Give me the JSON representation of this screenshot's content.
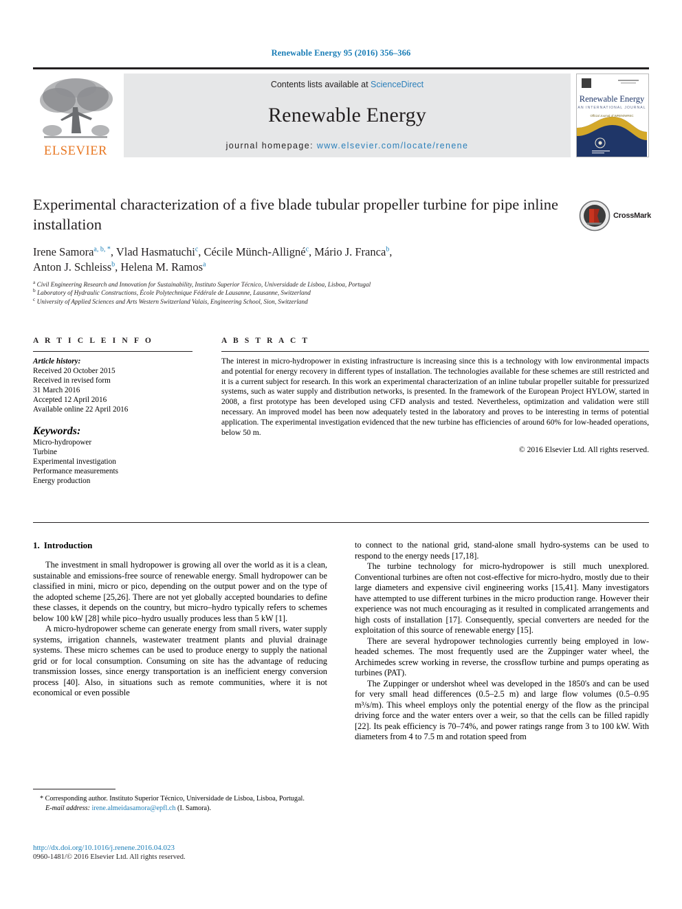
{
  "running_head": "Renewable Energy 95 (2016) 356–366",
  "masthead": {
    "publisher_name": "ELSEVIER",
    "contents_prefix": "Contents lists available at ",
    "contents_link": "ScienceDirect",
    "journal_title": "Renewable Energy",
    "homepage_prefix": "journal homepage: ",
    "homepage_url": "www.elsevier.com/locate/renene",
    "cover": {
      "title": "Renewable Energy",
      "subtitle": "AN INTERNATIONAL JOURNAL"
    }
  },
  "article": {
    "title": "Experimental characterization of a five blade tubular propeller turbine for pipe inline installation",
    "authors_line1": "Irene Samora",
    "authors_line1_sup": "a, b, *",
    "authors": [
      {
        "name": "Irene Samora",
        "sup": "a, b, *"
      },
      {
        "name": "Vlad Hasmatuchi",
        "sup": "c"
      },
      {
        "name": "Cécile Münch-Alligné",
        "sup": "c"
      },
      {
        "name": "Mário J. Franca",
        "sup": "b"
      },
      {
        "name": "Anton J. Schleiss",
        "sup": "b"
      },
      {
        "name": "Helena M. Ramos",
        "sup": "a"
      }
    ],
    "affiliations": [
      {
        "sup": "a",
        "text": "Civil Engineering Research and Innovation for Sustainability, Instituto Superior Técnico, Universidade de Lisboa, Lisboa, Portugal"
      },
      {
        "sup": "b",
        "text": "Laboratory of Hydraulic Constructions, École Polytechnique Fédérale de Lausanne, Lausanne, Switzerland"
      },
      {
        "sup": "c",
        "text": "University of Applied Sciences and Arts Western Switzerland Valais, Engineering School, Sion, Switzerland"
      }
    ],
    "crossmark_label": "CrossMark"
  },
  "article_info": {
    "heading": "A R T I C L E   I N F O",
    "history_label": "Article history:",
    "history": [
      "Received 20 October 2015",
      "Received in revised form",
      "31 March 2016",
      "Accepted 12 April 2016",
      "Available online 22 April 2016"
    ],
    "keywords_label": "Keywords:",
    "keywords": [
      "Micro-hydropower",
      "Turbine",
      "Experimental investigation",
      "Performance measurements",
      "Energy production"
    ]
  },
  "abstract": {
    "heading": "A B S T R A C T",
    "text": "The interest in micro-hydropower in existing infrastructure is increasing since this is a technology with low environmental impacts and potential for energy recovery in different types of installation. The technologies available for these schemes are still restricted and it is a current subject for research. In this work an experimental characterization of an inline tubular propeller suitable for pressurized systems, such as water supply and distribution networks, is presented. In the framework of the European Project HYLOW, started in 2008, a first prototype has been developed using CFD analysis and tested. Nevertheless, optimization and validation were still necessary. An improved model has been now adequately tested in the laboratory and proves to be interesting in terms of potential application. The experimental investigation evidenced that the new turbine has efficiencies of around 60% for low-headed operations, below 50 m.",
    "copyright": "© 2016 Elsevier Ltd. All rights reserved."
  },
  "body": {
    "section_number": "1.",
    "section_title": "Introduction",
    "left_paragraphs": [
      "The investment in small hydropower is growing all over the world as it is a clean, sustainable and emissions-free source of renewable energy. Small hydropower can be classified in mini, micro or pico, depending on the output power and on the type of the adopted scheme [25,26]. There are not yet globally accepted boundaries to define these classes, it depends on the country, but micro–hydro typically refers to schemes below 100 kW [28] while pico–hydro usually produces less than 5 kW [1].",
      "A micro-hydropower scheme can generate energy from small rivers, water supply systems, irrigation channels, wastewater treatment plants and pluvial drainage systems. These micro schemes can be used to produce energy to supply the national grid or for local consumption. Consuming on site has the advantage of reducing transmission losses, since energy transportation is an inefficient energy conversion process [40]. Also, in situations such as remote communities, where it is not economical or even possible"
    ],
    "right_paragraphs": [
      "to connect to the national grid, stand-alone small hydro-systems can be used to respond to the energy needs [17,18].",
      "The turbine technology for micro-hydropower is still much unexplored. Conventional turbines are often not cost-effective for micro-hydro, mostly due to their large diameters and expensive civil engineering works [15,41]. Many investigators have attempted to use different turbines in the micro production range. However their experience was not much encouraging as it resulted in complicated arrangements and high costs of installation [17]. Consequently, special converters are needed for the exploitation of this source of renewable energy [15].",
      "There are several hydropower technologies currently being employed in low-headed schemes. The most frequently used are the Zuppinger water wheel, the Archimedes screw working in reverse, the crossflow turbine and pumps operating as turbines (PAT).",
      "The Zuppinger or undershot wheel was developed in the 1850's and can be used for very small head differences (0.5–2.5 m) and large flow volumes (0.5–0.95 m³/s/m). This wheel employs only the potential energy of the flow as the principal driving force and the water enters over a weir, so that the cells can be filled rapidly [22]. Its peak efficiency is 70–74%, and power ratings range from 3 to 100 kW. With diameters from 4 to 7.5 m and rotation speed from"
    ]
  },
  "footnote": {
    "corresponding": "* Corresponding author. Instituto Superior Técnico, Universidade de Lisboa, Lisboa, Portugal.",
    "email_label": "E-mail address:",
    "email": "irene.almeidasamora@epfl.ch",
    "email_suffix": "(I. Samora)."
  },
  "footer": {
    "doi": "http://dx.doi.org/10.1016/j.renene.2016.04.023",
    "issn": "0960-1481/© 2016 Elsevier Ltd. All rights reserved."
  },
  "colors": {
    "link": "#1a7db6",
    "elsevier_orange": "#e87722",
    "masthead_grey": "#e6e7e8",
    "cover_navy": "#1f3668",
    "cover_gold": "#d4a829",
    "crossmark_red": "#c8341f"
  }
}
